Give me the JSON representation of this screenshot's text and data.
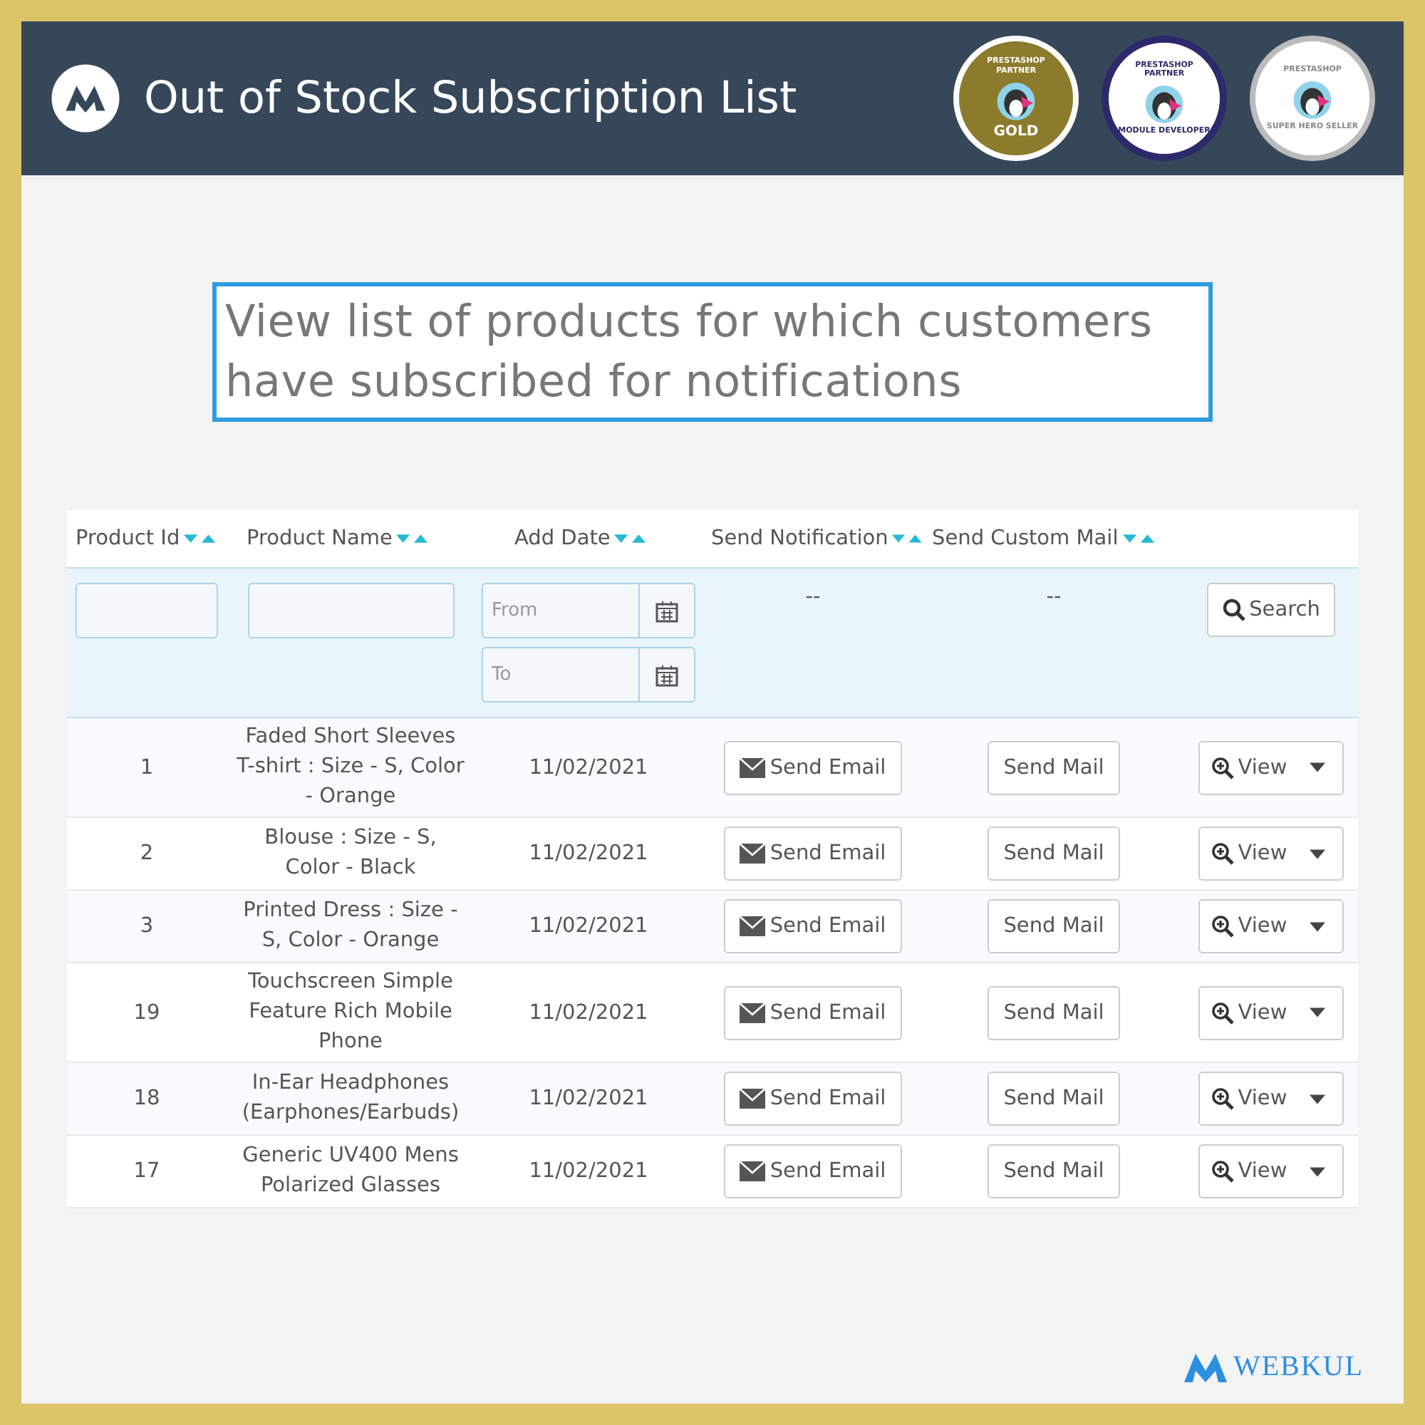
{
  "header": {
    "title": "Out of Stock Subscription List"
  },
  "badges": [
    {
      "top": "PRESTASHOP PARTNER",
      "bottom": "GOLD",
      "kind": "gold"
    },
    {
      "top": "PRESTASHOP PARTNER",
      "bottom": "MODULE DEVELOPER",
      "kind": "developer"
    },
    {
      "top": "PRESTASHOP",
      "bottom": "SUPER HERO SELLER",
      "kind": "hero"
    }
  ],
  "callout": "View list of products for which customers have subscribed for notifications",
  "table": {
    "columns": [
      "Product Id",
      "Product Name",
      "Add Date",
      "Send Notification",
      "Send Custom Mail"
    ],
    "filters": {
      "date_from_placeholder": "From",
      "date_to_placeholder": "To",
      "notification": "--",
      "custom_mail": "--",
      "search_button": "Search"
    },
    "rows": [
      {
        "id": "1",
        "name": "Faded Short Sleeves T-shirt : Size - S, Color - Orange",
        "date": "11/02/2021",
        "email": "Send Email",
        "mail": "Send Mail",
        "view": "View"
      },
      {
        "id": "2",
        "name": "Blouse : Size - S, Color - Black",
        "date": "11/02/2021",
        "email": "Send Email",
        "mail": "Send Mail",
        "view": "View"
      },
      {
        "id": "3",
        "name": "Printed Dress : Size - S, Color - Orange",
        "date": "11/02/2021",
        "email": "Send Email",
        "mail": "Send Mail",
        "view": "View"
      },
      {
        "id": "19",
        "name": "Touchscreen Simple Feature Rich Mobile Phone",
        "date": "11/02/2021",
        "email": "Send Email",
        "mail": "Send Mail",
        "view": "View"
      },
      {
        "id": "18",
        "name": "In-Ear Headphones (Earphones/Earbuds)",
        "date": "11/02/2021",
        "email": "Send Email",
        "mail": "Send Mail",
        "view": "View"
      },
      {
        "id": "17",
        "name": "Generic UV400 Mens Polarized Glasses",
        "date": "11/02/2021",
        "email": "Send Email",
        "mail": "Send Mail",
        "view": "View"
      }
    ]
  },
  "footer_logo": "WEBKUL"
}
